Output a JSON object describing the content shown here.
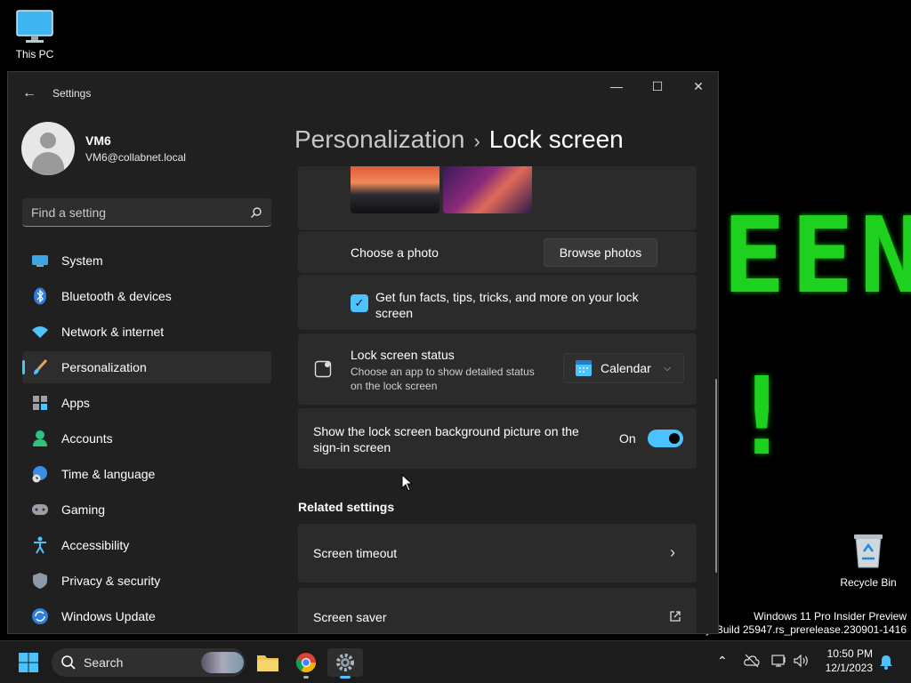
{
  "desktop": {
    "this_pc_label": "This PC",
    "recycle_bin_label": "Recycle Bin",
    "background_text_top": "EEN",
    "background_text_bottom": "!",
    "watermark_line1": "Windows 11 Pro Insider Preview",
    "watermark_line2": "y. Build 25947.rs_prerelease.230901-1416"
  },
  "window": {
    "title": "Settings",
    "minimize": "—",
    "maximize": "☐",
    "close": "✕"
  },
  "profile": {
    "name": "VM6",
    "email": "VM6@collabnet.local"
  },
  "search": {
    "placeholder": "Find a setting"
  },
  "nav": {
    "items": [
      {
        "label": "System",
        "icon": "system-icon"
      },
      {
        "label": "Bluetooth & devices",
        "icon": "bluetooth-icon"
      },
      {
        "label": "Network & internet",
        "icon": "wifi-icon"
      },
      {
        "label": "Personalization",
        "icon": "brush-icon",
        "active": true
      },
      {
        "label": "Apps",
        "icon": "apps-icon"
      },
      {
        "label": "Accounts",
        "icon": "accounts-icon"
      },
      {
        "label": "Time & language",
        "icon": "globe-clock-icon"
      },
      {
        "label": "Gaming",
        "icon": "gamepad-icon"
      },
      {
        "label": "Accessibility",
        "icon": "accessibility-icon"
      },
      {
        "label": "Privacy & security",
        "icon": "shield-icon"
      },
      {
        "label": "Windows Update",
        "icon": "update-icon"
      }
    ]
  },
  "breadcrumb": {
    "parent": "Personalization",
    "separator": "›",
    "current": "Lock screen"
  },
  "lock_screen": {
    "choose_photo_label": "Choose a photo",
    "browse_photos_button": "Browse photos",
    "fun_facts_label": "Get fun facts, tips, tricks, and more on your lock screen",
    "fun_facts_checked": true,
    "status_title": "Lock screen status",
    "status_desc": "Choose an app to show detailed status on the lock screen",
    "status_selected": "Calendar",
    "signin_bg_label": "Show the lock screen background picture on the sign-in screen",
    "signin_bg_state": "On",
    "related_heading": "Related settings",
    "screen_timeout": "Screen timeout",
    "screen_saver": "Screen saver"
  },
  "taskbar": {
    "search_label": "Search",
    "time": "10:50 PM",
    "date": "12/1/2023"
  },
  "colors": {
    "accent": "#4cc2ff",
    "window_bg": "#202020",
    "card_bg": "#2b2b2b",
    "desktop_segment_green": "#1fd11f"
  }
}
